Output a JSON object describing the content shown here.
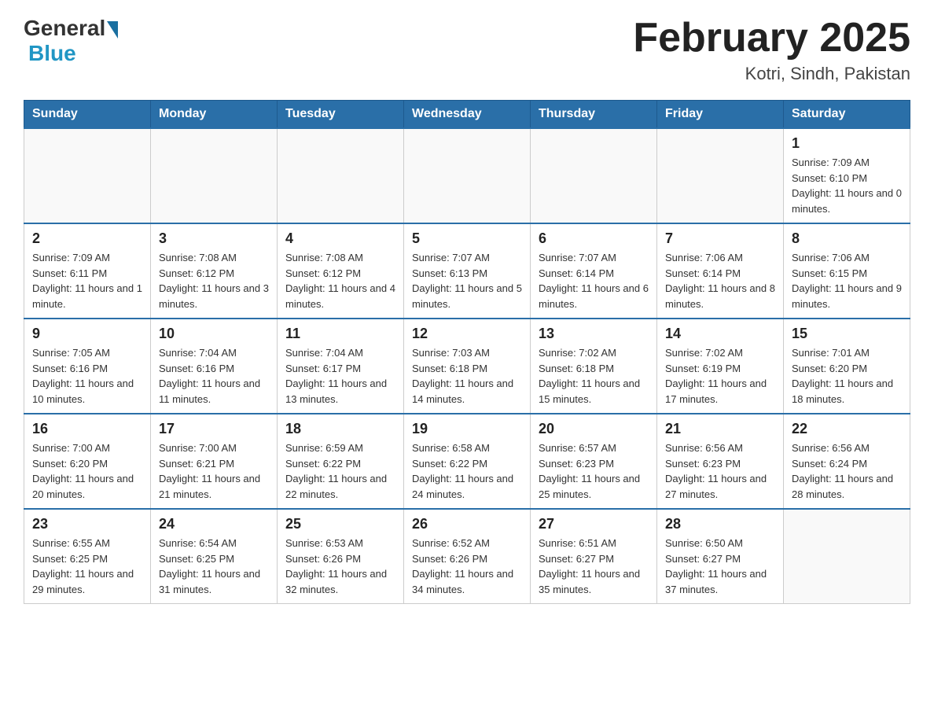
{
  "header": {
    "logo": {
      "general": "General",
      "blue": "Blue"
    },
    "title": "February 2025",
    "location": "Kotri, Sindh, Pakistan"
  },
  "days_of_week": [
    "Sunday",
    "Monday",
    "Tuesday",
    "Wednesday",
    "Thursday",
    "Friday",
    "Saturday"
  ],
  "weeks": [
    [
      {
        "day": "",
        "info": ""
      },
      {
        "day": "",
        "info": ""
      },
      {
        "day": "",
        "info": ""
      },
      {
        "day": "",
        "info": ""
      },
      {
        "day": "",
        "info": ""
      },
      {
        "day": "",
        "info": ""
      },
      {
        "day": "1",
        "info": "Sunrise: 7:09 AM\nSunset: 6:10 PM\nDaylight: 11 hours and 0 minutes."
      }
    ],
    [
      {
        "day": "2",
        "info": "Sunrise: 7:09 AM\nSunset: 6:11 PM\nDaylight: 11 hours and 1 minute."
      },
      {
        "day": "3",
        "info": "Sunrise: 7:08 AM\nSunset: 6:12 PM\nDaylight: 11 hours and 3 minutes."
      },
      {
        "day": "4",
        "info": "Sunrise: 7:08 AM\nSunset: 6:12 PM\nDaylight: 11 hours and 4 minutes."
      },
      {
        "day": "5",
        "info": "Sunrise: 7:07 AM\nSunset: 6:13 PM\nDaylight: 11 hours and 5 minutes."
      },
      {
        "day": "6",
        "info": "Sunrise: 7:07 AM\nSunset: 6:14 PM\nDaylight: 11 hours and 6 minutes."
      },
      {
        "day": "7",
        "info": "Sunrise: 7:06 AM\nSunset: 6:14 PM\nDaylight: 11 hours and 8 minutes."
      },
      {
        "day": "8",
        "info": "Sunrise: 7:06 AM\nSunset: 6:15 PM\nDaylight: 11 hours and 9 minutes."
      }
    ],
    [
      {
        "day": "9",
        "info": "Sunrise: 7:05 AM\nSunset: 6:16 PM\nDaylight: 11 hours and 10 minutes."
      },
      {
        "day": "10",
        "info": "Sunrise: 7:04 AM\nSunset: 6:16 PM\nDaylight: 11 hours and 11 minutes."
      },
      {
        "day": "11",
        "info": "Sunrise: 7:04 AM\nSunset: 6:17 PM\nDaylight: 11 hours and 13 minutes."
      },
      {
        "day": "12",
        "info": "Sunrise: 7:03 AM\nSunset: 6:18 PM\nDaylight: 11 hours and 14 minutes."
      },
      {
        "day": "13",
        "info": "Sunrise: 7:02 AM\nSunset: 6:18 PM\nDaylight: 11 hours and 15 minutes."
      },
      {
        "day": "14",
        "info": "Sunrise: 7:02 AM\nSunset: 6:19 PM\nDaylight: 11 hours and 17 minutes."
      },
      {
        "day": "15",
        "info": "Sunrise: 7:01 AM\nSunset: 6:20 PM\nDaylight: 11 hours and 18 minutes."
      }
    ],
    [
      {
        "day": "16",
        "info": "Sunrise: 7:00 AM\nSunset: 6:20 PM\nDaylight: 11 hours and 20 minutes."
      },
      {
        "day": "17",
        "info": "Sunrise: 7:00 AM\nSunset: 6:21 PM\nDaylight: 11 hours and 21 minutes."
      },
      {
        "day": "18",
        "info": "Sunrise: 6:59 AM\nSunset: 6:22 PM\nDaylight: 11 hours and 22 minutes."
      },
      {
        "day": "19",
        "info": "Sunrise: 6:58 AM\nSunset: 6:22 PM\nDaylight: 11 hours and 24 minutes."
      },
      {
        "day": "20",
        "info": "Sunrise: 6:57 AM\nSunset: 6:23 PM\nDaylight: 11 hours and 25 minutes."
      },
      {
        "day": "21",
        "info": "Sunrise: 6:56 AM\nSunset: 6:23 PM\nDaylight: 11 hours and 27 minutes."
      },
      {
        "day": "22",
        "info": "Sunrise: 6:56 AM\nSunset: 6:24 PM\nDaylight: 11 hours and 28 minutes."
      }
    ],
    [
      {
        "day": "23",
        "info": "Sunrise: 6:55 AM\nSunset: 6:25 PM\nDaylight: 11 hours and 29 minutes."
      },
      {
        "day": "24",
        "info": "Sunrise: 6:54 AM\nSunset: 6:25 PM\nDaylight: 11 hours and 31 minutes."
      },
      {
        "day": "25",
        "info": "Sunrise: 6:53 AM\nSunset: 6:26 PM\nDaylight: 11 hours and 32 minutes."
      },
      {
        "day": "26",
        "info": "Sunrise: 6:52 AM\nSunset: 6:26 PM\nDaylight: 11 hours and 34 minutes."
      },
      {
        "day": "27",
        "info": "Sunrise: 6:51 AM\nSunset: 6:27 PM\nDaylight: 11 hours and 35 minutes."
      },
      {
        "day": "28",
        "info": "Sunrise: 6:50 AM\nSunset: 6:27 PM\nDaylight: 11 hours and 37 minutes."
      },
      {
        "day": "",
        "info": ""
      }
    ]
  ]
}
